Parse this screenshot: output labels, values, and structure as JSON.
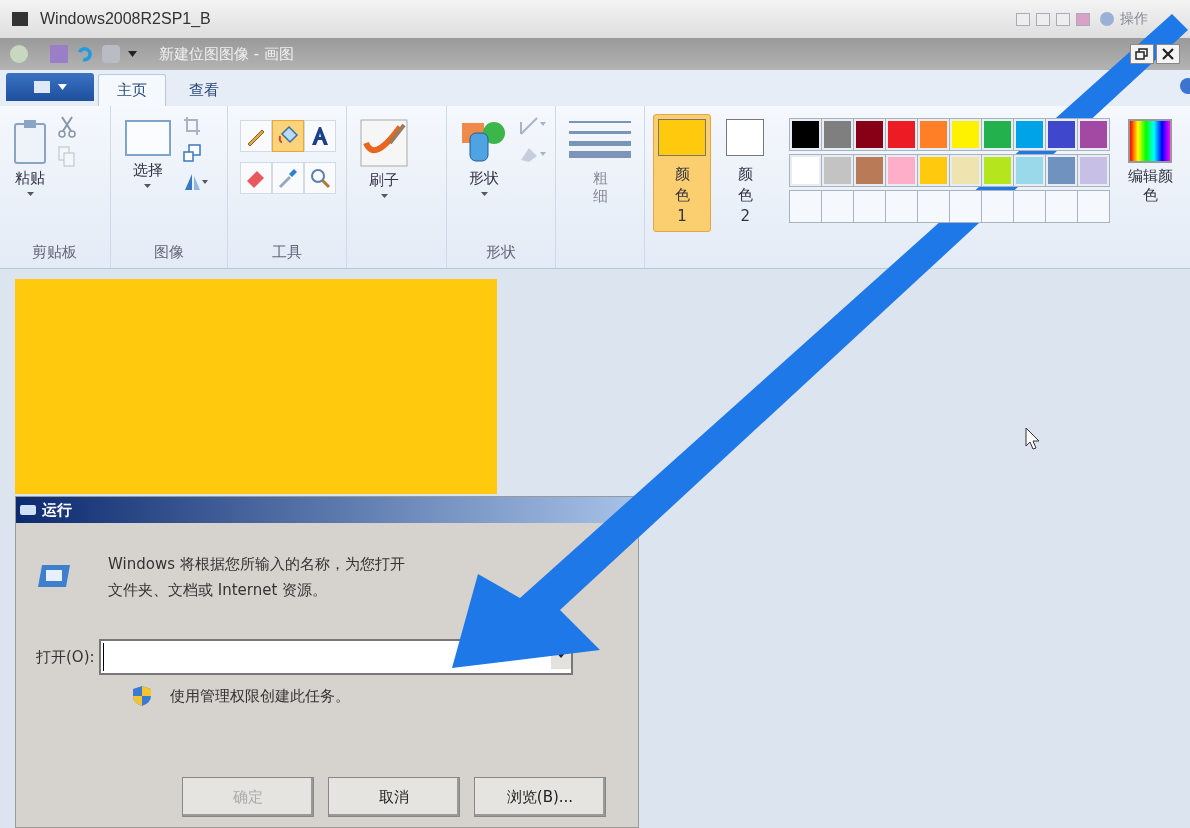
{
  "host_window": {
    "title": "Windows2008R2SP1_B",
    "menu": "操作"
  },
  "paint": {
    "title": "新建位图图像 - 画图",
    "tabs": [
      {
        "label": "主页",
        "selected": true
      },
      {
        "label": "查看",
        "selected": false
      }
    ],
    "clipboard": {
      "paste": "粘贴",
      "label": "剪贴板"
    },
    "image": {
      "select": "选择",
      "label": "图像"
    },
    "tools": {
      "label": "工具",
      "items": [
        {
          "kind": "pencil",
          "selected": false
        },
        {
          "kind": "fill",
          "selected": true
        },
        {
          "kind": "text",
          "selected": false
        },
        {
          "kind": "eraser",
          "selected": false
        },
        {
          "kind": "picker",
          "selected": false
        },
        {
          "kind": "magnifier",
          "selected": false
        }
      ]
    },
    "brushes": {
      "label": "刷子"
    },
    "shapes": {
      "button": "形状",
      "label": "形状"
    },
    "size": {
      "label": "粗细"
    },
    "colors": [
      {
        "label": "颜色 1",
        "color": "#ffc90e",
        "selected": true
      },
      {
        "label": "颜色 2",
        "color": "#ffffff",
        "selected": false
      }
    ],
    "swatches": [
      {
        "kind": "color",
        "color": "#000000"
      },
      {
        "kind": "color",
        "color": "#7f7f7f"
      },
      {
        "kind": "color",
        "color": "#880015"
      },
      {
        "kind": "color",
        "color": "#ed1c24"
      },
      {
        "kind": "color",
        "color": "#ff7f27"
      },
      {
        "kind": "color",
        "color": "#fff200"
      },
      {
        "kind": "color",
        "color": "#22b14c"
      },
      {
        "kind": "color",
        "color": "#00a2e8"
      },
      {
        "kind": "color",
        "color": "#3f48cc"
      },
      {
        "kind": "color",
        "color": "#a349a4"
      },
      {
        "kind": "color",
        "color": "#ffffff"
      },
      {
        "kind": "color",
        "color": "#c3c3c3"
      },
      {
        "kind": "color",
        "color": "#b97a57"
      },
      {
        "kind": "color",
        "color": "#ffaec9"
      },
      {
        "kind": "color",
        "color": "#ffc90e"
      },
      {
        "kind": "color",
        "color": "#efe4b0"
      },
      {
        "kind": "color",
        "color": "#b5e61d"
      },
      {
        "kind": "color",
        "color": "#99d9ea"
      },
      {
        "kind": "color",
        "color": "#7092be"
      },
      {
        "kind": "color",
        "color": "#c8bfe7"
      },
      {
        "kind": "empty"
      },
      {
        "kind": "empty"
      },
      {
        "kind": "empty"
      },
      {
        "kind": "empty"
      },
      {
        "kind": "empty"
      },
      {
        "kind": "empty"
      },
      {
        "kind": "empty"
      },
      {
        "kind": "empty"
      },
      {
        "kind": "empty"
      },
      {
        "kind": "empty"
      }
    ],
    "edit_colors": "编辑颜色"
  },
  "run_dialog": {
    "title": "运行",
    "message_lines": [
      "Windows 将根据您所输入的名称，为您打开",
      "文件夹、文档或 Internet 资源。"
    ],
    "open_label": "打开(O):",
    "admin_note": "使用管理权限创建此任务。",
    "buttons": [
      {
        "label": "确定",
        "disabled": true
      },
      {
        "label": "取消",
        "disabled": false
      },
      {
        "label": "浏览(B)...",
        "disabled": false
      }
    ]
  }
}
